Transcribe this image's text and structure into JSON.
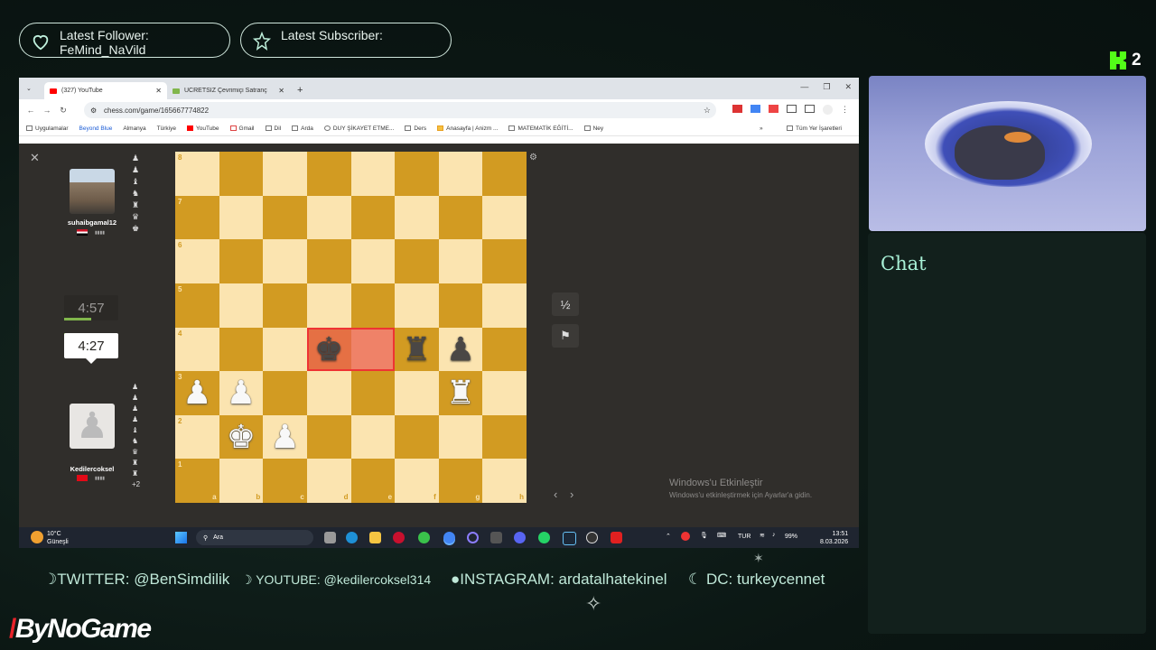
{
  "overlay": {
    "follower_label": "Latest Follower:",
    "follower_name": "FeMind_NaVild",
    "subscriber_label": "Latest Subscriber:",
    "viewer_count": "2",
    "chat_title": "Chat",
    "social_twitter": "TWITTER: @BenSimdilik",
    "social_youtube": "YOUTUBE: @kedilercoksel314",
    "social_instagram": "INSTAGRAM: ardatalhatekinel",
    "social_discord": "DC: turkeycennet",
    "brand": "ByNoGame",
    "accent": "#53fc18"
  },
  "browser": {
    "tabs": [
      {
        "label": "(327) YouTube",
        "active": true
      },
      {
        "label": "ÜCRETSİZ Çevrimiçi Satranç",
        "active": false
      }
    ],
    "url": "chess.com/game/165667774822",
    "bookmarks": [
      "Uygulamalar",
      "Beyond Blue",
      "Almanya",
      "Türkiye",
      "YouTube",
      "Gmail",
      "Dil",
      "Arda",
      "DUY ŞİKAYET ETME...",
      "Ders",
      "Anasayfa | Anizm ...",
      "MATEMATİK EĞİTİ...",
      "Ney"
    ],
    "bookmarks_right": "Tüm Yer İşaretleri"
  },
  "game": {
    "opponent": {
      "name": "suhaibgamal12",
      "clock": "4:57"
    },
    "player": {
      "name": "Kedilercoksel",
      "clock": "4:27",
      "captured_extra": "+2"
    },
    "ranks": [
      "8",
      "7",
      "6",
      "5",
      "4",
      "3",
      "2",
      "1"
    ],
    "files": [
      "a",
      "b",
      "c",
      "d",
      "e",
      "f",
      "g",
      "h"
    ],
    "draw_button": "½",
    "resign_icon": "flag-icon",
    "pieces": [
      {
        "sq": "d4",
        "glyph": "♚",
        "color": "black",
        "name": "black-king"
      },
      {
        "sq": "f4",
        "glyph": "♜",
        "color": "black",
        "name": "black-rook"
      },
      {
        "sq": "g4",
        "glyph": "♟",
        "color": "black",
        "name": "black-pawn"
      },
      {
        "sq": "a3",
        "glyph": "♟",
        "color": "white",
        "name": "white-pawn"
      },
      {
        "sq": "b3",
        "glyph": "♟",
        "color": "white",
        "name": "white-pawn"
      },
      {
        "sq": "g3",
        "glyph": "♜",
        "color": "white",
        "name": "white-rook"
      },
      {
        "sq": "b2",
        "glyph": "♚",
        "color": "white",
        "name": "white-king"
      },
      {
        "sq": "c2",
        "glyph": "♟",
        "color": "white",
        "name": "white-pawn"
      }
    ],
    "highlight_squares": [
      "d4",
      "e4"
    ]
  },
  "windows": {
    "activate_title": "Windows'u Etkinleştir",
    "activate_sub": "Windows'u etkinleştirmek için Ayarlar'a gidin.",
    "weather_temp": "10°C",
    "weather_desc": "Güneşli",
    "search": "Ara",
    "lang": "TUR",
    "battery": "99%",
    "time": "13:51",
    "date": "8.03.2026"
  }
}
